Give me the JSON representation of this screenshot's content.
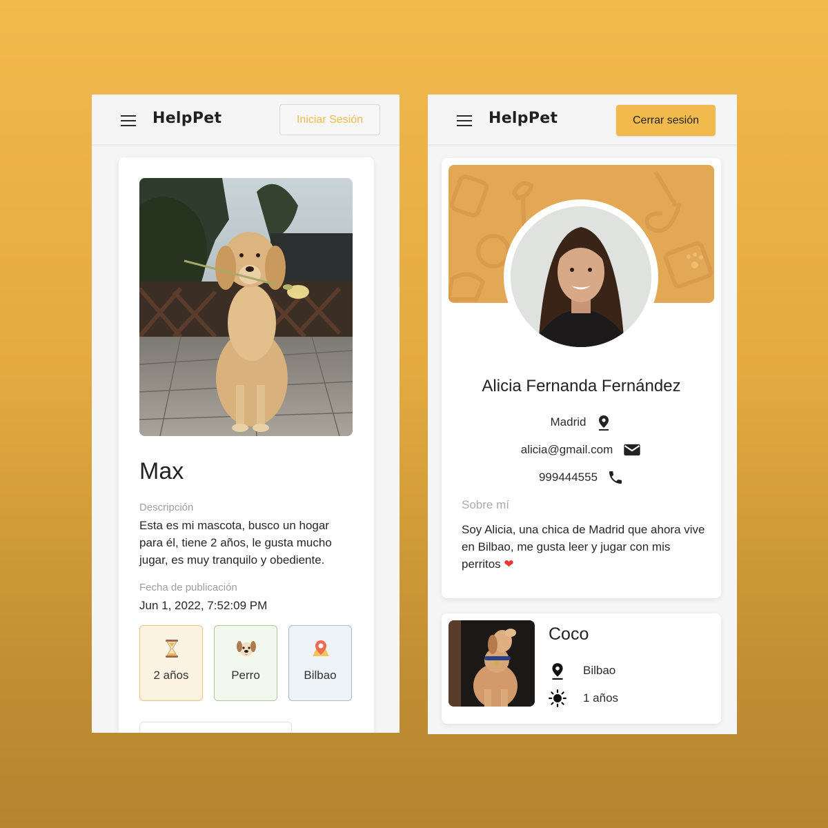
{
  "left_screen": {
    "app_name": "HelpPet",
    "login_label": "Iniciar Sesión",
    "pet": {
      "name": "Max",
      "description_label": "Descripción",
      "description": "Esta es mi mascota, busco un hogar para él, tiene 2 años, le gusta mucho jugar, es muy tranquilo y obediente.",
      "date_label": "Fecha de publicación",
      "date": "Jun 1, 2022, 7:52:09 PM",
      "chips": [
        {
          "icon": "hourglass-icon",
          "label": "2 años",
          "color": "#fdf3e2"
        },
        {
          "icon": "dog-icon",
          "label": "Perro",
          "color": "#f3f8ef"
        },
        {
          "icon": "map-pin-icon",
          "label": "Bilbao",
          "color": "#eef3f7"
        }
      ]
    }
  },
  "right_screen": {
    "app_name": "HelpPet",
    "logout_label": "Cerrar sesión",
    "profile": {
      "name": "Alicia Fernanda Fernández",
      "city": "Madrid",
      "email": "alicia@gmail.com",
      "phone": "999444555",
      "about_label": "Sobre mí",
      "about": "Soy Alicia, una chica de Madrid que ahora vive en Bilbao, me gusta leer y jugar con mis perritos",
      "about_emoji": "❤"
    },
    "pet_card": {
      "name": "Coco",
      "city": "Bilbao",
      "age": "1 años"
    }
  },
  "colors": {
    "accent": "#f2b94d",
    "banner": "#e3a855"
  }
}
